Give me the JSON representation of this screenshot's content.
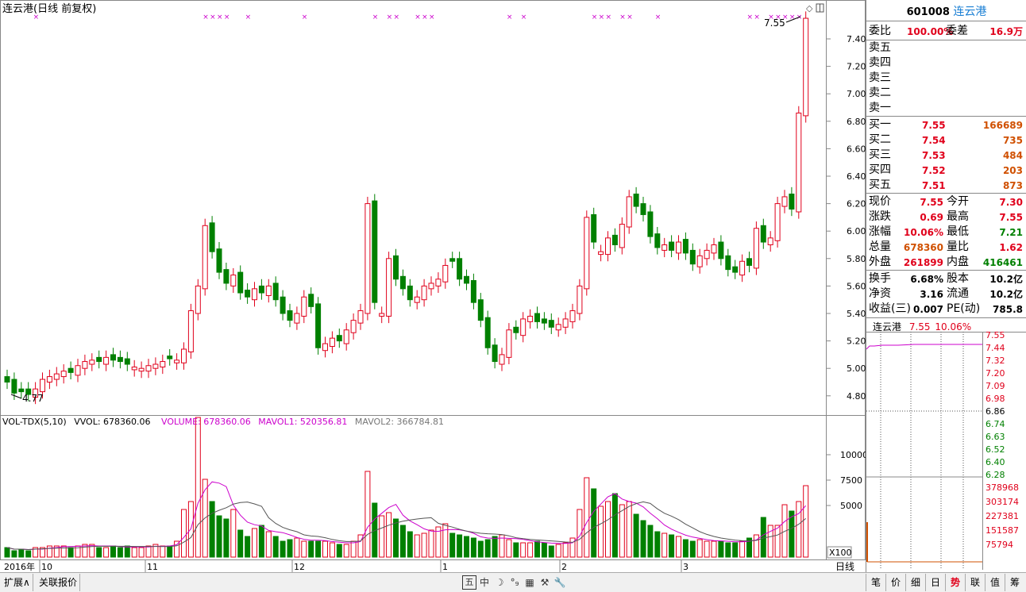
{
  "chart": {
    "title": "连云港(日线 前复权)",
    "price_labels": [
      "7.40",
      "7.20",
      "7.00",
      "6.80",
      "6.60",
      "6.40",
      "6.20",
      "6.00",
      "5.80",
      "5.60",
      "5.40",
      "5.20",
      "5.00",
      "4.80"
    ],
    "high_marker": "7.55",
    "low_marker": "4.77",
    "vol_legend": {
      "name": "VOL-TDX(5,10)",
      "vvol": "VVOL: 678360.06",
      "volume": "VOLUME: 678360.06",
      "mavol1": "MAVOL1: 520356.81",
      "mavol2": "MAVOL2: 366784.81"
    },
    "vol_labels": [
      "10000",
      "7500",
      "5000"
    ],
    "vol_unit": "X100",
    "x_labels": [
      "2016年",
      "10",
      "11",
      "12",
      "1",
      "2",
      "3"
    ],
    "period_label": "日线",
    "colors": {
      "up": "#e0001b",
      "down": "#008000",
      "ma1": "#cc00cc",
      "ma2": "#555555",
      "marker": "#cc00cc"
    }
  },
  "quote": {
    "code": "601008",
    "name": "连云港",
    "weibi_label": "委比",
    "weibi": "100.00%",
    "weicha_label": "委差",
    "weicha": "16.9万",
    "sells": [
      "卖五",
      "卖四",
      "卖三",
      "卖二",
      "卖一"
    ],
    "buys": [
      {
        "label": "买一",
        "price": "7.55",
        "vol": "166689"
      },
      {
        "label": "买二",
        "price": "7.54",
        "vol": "735"
      },
      {
        "label": "买三",
        "price": "7.53",
        "vol": "484"
      },
      {
        "label": "买四",
        "price": "7.52",
        "vol": "203"
      },
      {
        "label": "买五",
        "price": "7.51",
        "vol": "873"
      }
    ],
    "stats": [
      {
        "l1": "现价",
        "v1": "7.55",
        "l2": "今开",
        "v2": "7.30"
      },
      {
        "l1": "涨跌",
        "v1": "0.69",
        "l2": "最高",
        "v2": "7.55"
      },
      {
        "l1": "涨幅",
        "v1": "10.06%",
        "l2": "最低",
        "v2": "7.21"
      },
      {
        "l1": "总量",
        "v1": "678360",
        "l2": "量比",
        "v2": "1.62"
      },
      {
        "l1": "外盘",
        "v1": "261899",
        "l2": "内盘",
        "v2": "416461"
      }
    ],
    "stats2": [
      {
        "l1": "换手",
        "v1": "6.68%",
        "l2": "股本",
        "v2": "10.2亿"
      },
      {
        "l1": "净资",
        "v1": "3.16",
        "l2": "流通",
        "v2": "10.2亿"
      },
      {
        "l1": "收益(三)",
        "v1": "0.007",
        "l2": "PE(动)",
        "v2": "785.8"
      }
    ],
    "mini_title": "连云港",
    "mini_price": "7.55",
    "mini_pct": "10.06%",
    "mini_price_labels": [
      "7.55",
      "7.44",
      "7.32",
      "7.20",
      "7.09",
      "6.98",
      "6.86",
      "6.74",
      "6.63",
      "6.52",
      "6.40",
      "6.28"
    ],
    "mini_vol_labels": [
      "378968",
      "303174",
      "227381",
      "151587",
      "75794"
    ]
  },
  "bottom": {
    "tabs": [
      "扩展∧",
      "关联报价"
    ],
    "tools": [
      "五",
      "中",
      "☽",
      "°₉",
      "▦",
      "⚒",
      "🔧"
    ],
    "right_tabs": [
      "笔",
      "价",
      "细",
      "日",
      "势",
      "联",
      "值",
      "筹"
    ]
  }
}
